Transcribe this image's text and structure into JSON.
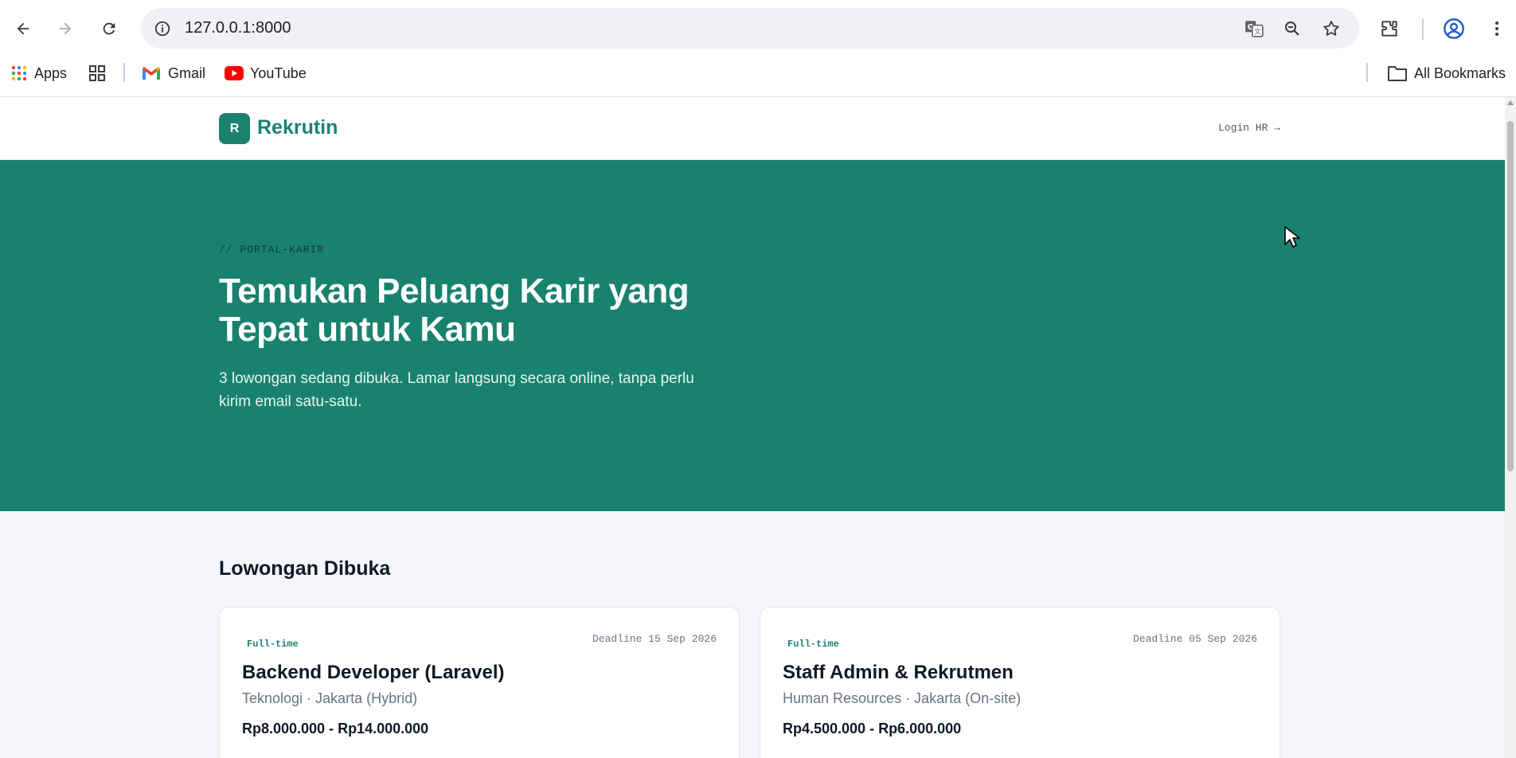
{
  "browser": {
    "url": "127.0.0.1:8000",
    "bookmarks": [
      {
        "label": "Apps",
        "icon": "apps-grid-icon"
      },
      {
        "label": "",
        "icon": "tab-groups-icon"
      },
      {
        "label": "Gmail",
        "icon": "gmail-icon"
      },
      {
        "label": "YouTube",
        "icon": "youtube-icon"
      }
    ],
    "all_bookmarks_label": "All Bookmarks"
  },
  "site": {
    "logo_letter": "R",
    "brand": "Rekrutin",
    "login_label": "Login HR →"
  },
  "hero": {
    "eyebrow": "// PORTAL-KARIR",
    "title": "Temukan Peluang Karir yang Tepat untuk Kamu",
    "subtitle": "3 lowongan sedang dibuka. Lamar langsung secara online, tanpa perlu kirim email satu-satu."
  },
  "jobs": {
    "section_title": "Lowongan Dibuka",
    "items": [
      {
        "type": "Full-time",
        "deadline": "Deadline 15 Sep 2026",
        "title": "Backend Developer (Laravel)",
        "meta": "Teknologi · Jakarta (Hybrid)",
        "salary": "Rp8.000.000 - Rp14.000.000"
      },
      {
        "type": "Full-time",
        "deadline": "Deadline 05 Sep 2026",
        "title": "Staff Admin & Rekrutmen",
        "meta": "Human Resources · Jakarta (On-site)",
        "salary": "Rp4.500.000 - Rp6.000.000"
      }
    ]
  },
  "colors": {
    "brand": "#1b826f",
    "hero_bg": "#19826e",
    "page_bg": "#f4f6fa"
  }
}
